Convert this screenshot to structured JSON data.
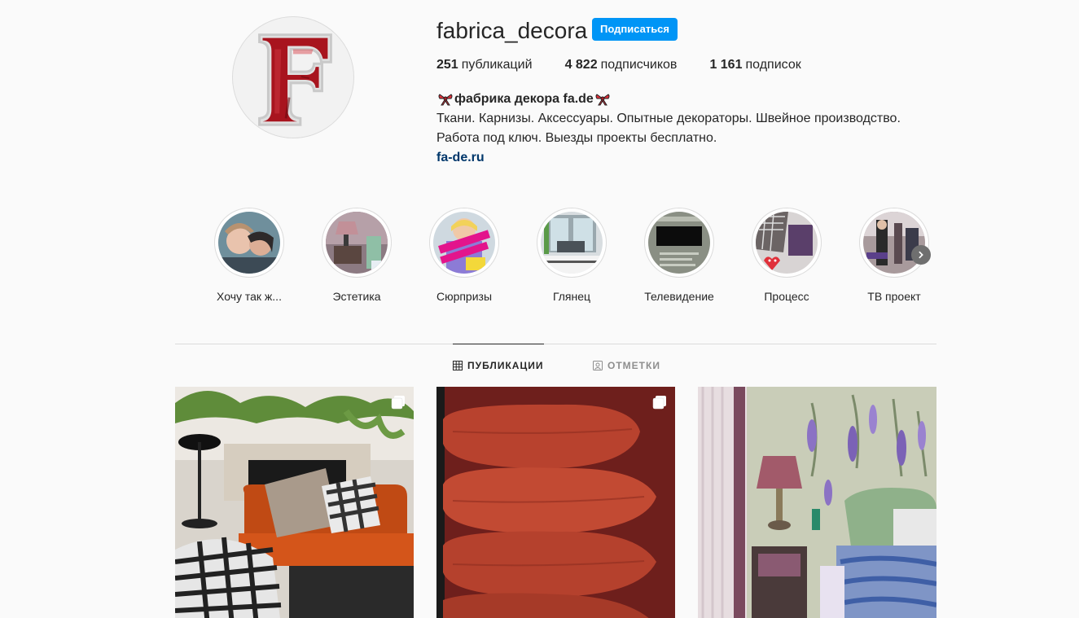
{
  "profile": {
    "username": "fabrica_decora",
    "follow_label": "Подписаться",
    "avatar_letter": "F"
  },
  "stats": {
    "posts_count": "251",
    "posts_label": "публикаций",
    "followers_count": "4 822",
    "followers_label": "подписчиков",
    "following_count": "1 161",
    "following_label": "подписок"
  },
  "bio": {
    "name": "фабрика декора fa.de",
    "line1": "Ткани. Карнизы. Аксессуары. Опытные декораторы. Швейное производство.",
    "line2": "Работа под ключ. Выезды проекты бесплатно.",
    "link": "fa-de.ru"
  },
  "highlights": [
    {
      "label": "Хочу так ж..."
    },
    {
      "label": "Эстетика"
    },
    {
      "label": "Сюрпризы"
    },
    {
      "label": "Глянец"
    },
    {
      "label": "Телевидение"
    },
    {
      "label": "Процесс"
    },
    {
      "label": "ТВ проект"
    }
  ],
  "tabs": {
    "posts": "ПУБЛИКАЦИИ",
    "tagged": "ОТМЕТКИ"
  },
  "icons": {
    "bio_decoration": "ribbon-icon",
    "next": "chevron-right-icon",
    "posts_tab": "grid-icon",
    "tagged_tab": "tag-portrait-icon",
    "multi": "multiple-images-icon"
  },
  "colors": {
    "accent": "#0095f6",
    "link": "#00376b",
    "text": "#262626",
    "muted": "#8e8e8e",
    "background": "#fafafa"
  }
}
